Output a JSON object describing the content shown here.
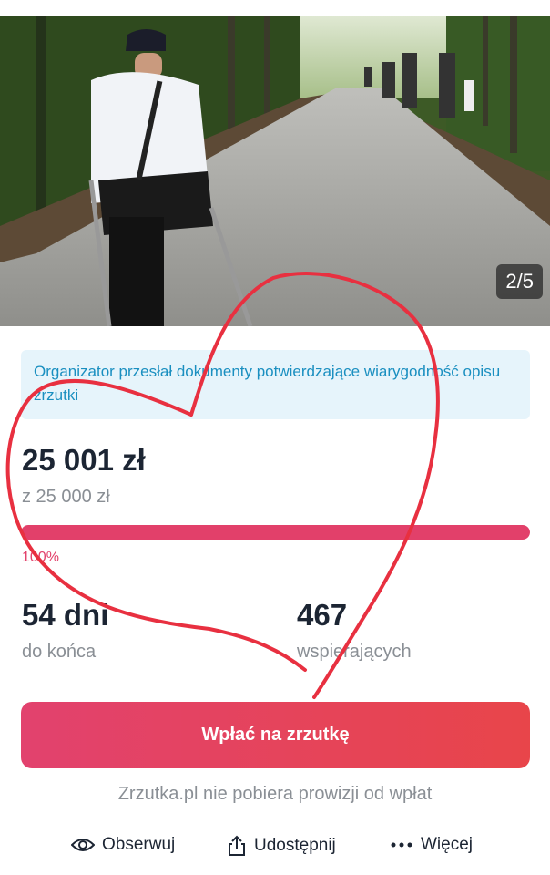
{
  "gallery": {
    "counter": "2/5"
  },
  "notice": {
    "text": "Organizator przesłał dokumenty potwierdzające wiarygodność opisu zrzutki"
  },
  "funding": {
    "raised": "25 001 zł",
    "goal": "z 25 000 zł",
    "percent_label": "100%",
    "progress_fraction": 1.0
  },
  "stats": {
    "days_value": "54 dni",
    "days_label": "do końca",
    "supporters_value": "467",
    "supporters_label": "wspierających"
  },
  "cta": {
    "label": "Wpłać na zrzutkę"
  },
  "fee_note": "Zrzutka.pl nie pobiera prowizji od wpłat",
  "actions": {
    "follow": "Obserwuj",
    "share": "Udostępnij",
    "more": "Więcej"
  },
  "colors": {
    "accent": "#e2406a",
    "notice_bg": "#e6f4fb",
    "notice_text": "#1a8fc0",
    "annotation": "#e83040"
  }
}
